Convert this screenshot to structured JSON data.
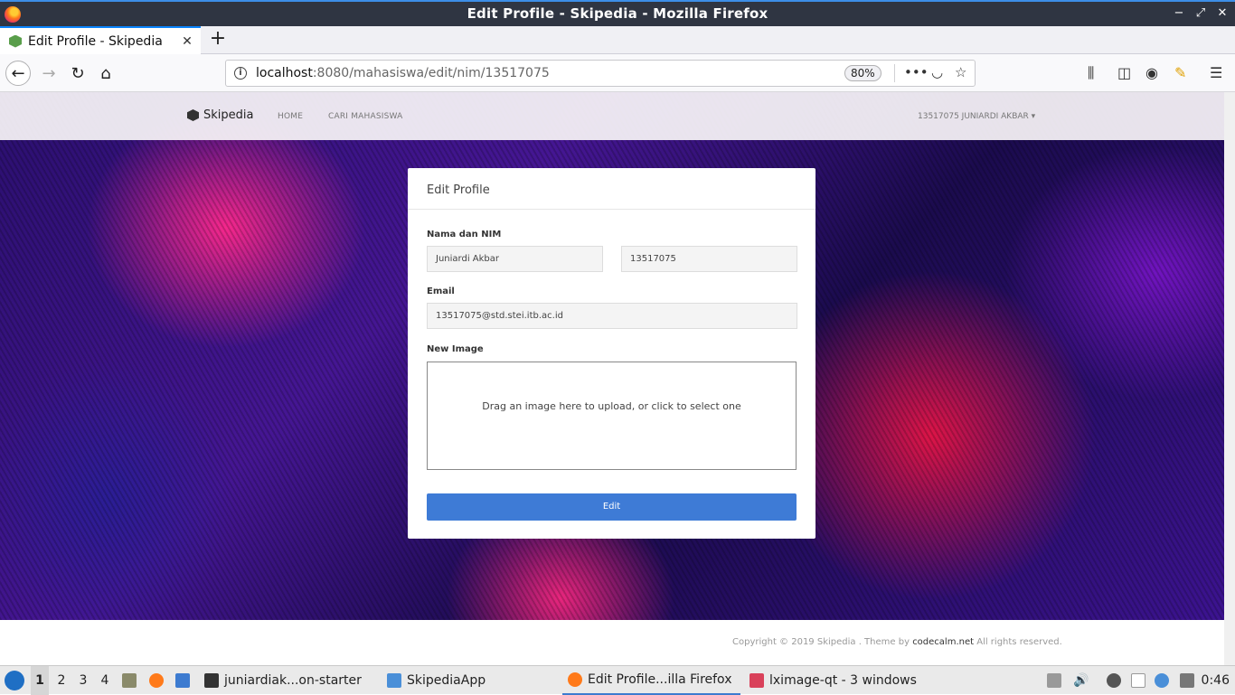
{
  "window": {
    "title": "Edit Profile - Skipedia - Mozilla Firefox"
  },
  "tabs": [
    {
      "label": "Edit Profile - Skipedia",
      "active": true
    }
  ],
  "browser": {
    "url_host": "localhost",
    "url_path": ":8080/mahasiswa/edit/nim/13517075",
    "zoom": "80%"
  },
  "site": {
    "brand": "Skipedia",
    "nav": [
      {
        "label": "HOME"
      },
      {
        "label": "CARI MAHASISWA"
      }
    ],
    "user_menu": "13517075 JUNIARDI AKBAR"
  },
  "form": {
    "title": "Edit Profile",
    "name_nim_label": "Nama dan NIM",
    "name_value": "Juniardi Akbar",
    "nim_value": "13517075",
    "email_label": "Email",
    "email_value": "13517075@std.stei.itb.ac.id",
    "image_label": "New Image",
    "dropzone_message": "Drag an image here to upload, or click to select one",
    "submit_label": "Edit"
  },
  "footer": {
    "prefix": "Copyright © 2019 Skipedia . Theme by",
    "link": "codecalm.net",
    "suffix": "All rights reserved."
  },
  "taskbar": {
    "workspaces": [
      "1",
      "2",
      "3",
      "4"
    ],
    "tasks": [
      {
        "label": "juniardiak...on-starter"
      },
      {
        "label": "SkipediaApp"
      },
      {
        "label": "Edit Profile...illa Firefox",
        "active": true
      },
      {
        "label": "lximage-qt - 3 windows"
      }
    ],
    "clock": "0:46"
  },
  "colors": {
    "primary_button": "#3e7bd6",
    "tab_accent": "#0a84ff",
    "titlebar_bg": "#2f3542"
  }
}
